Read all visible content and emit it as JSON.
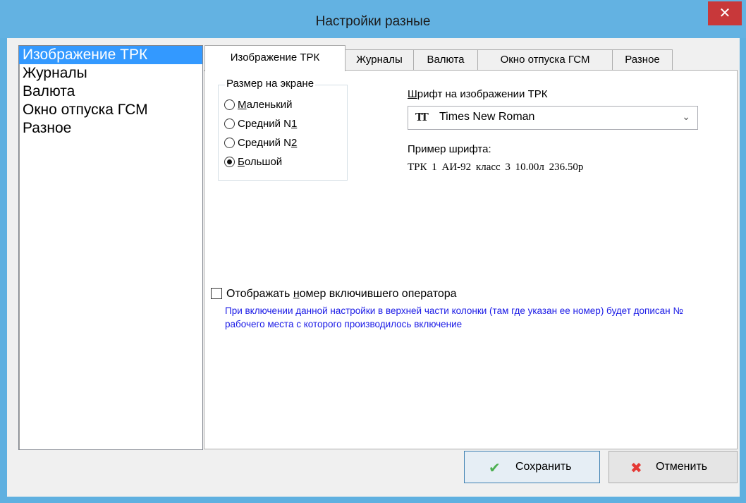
{
  "window": {
    "title": "Настройки разные",
    "close_glyph": "✕"
  },
  "sidebar": {
    "items": [
      {
        "label": "Изображение ТРК",
        "selected": true
      },
      {
        "label": "Журналы"
      },
      {
        "label": "Валюта"
      },
      {
        "label": "Окно отпуска ГСМ"
      },
      {
        "label": "Разное"
      }
    ]
  },
  "tabs": [
    {
      "label": "Изображение ТРК",
      "active": true
    },
    {
      "label": "Журналы"
    },
    {
      "label": "Валюта"
    },
    {
      "label": "Окно отпуска ГСМ"
    },
    {
      "label": "Разное"
    }
  ],
  "screen_size_group": {
    "title": "Размер на экране",
    "options": [
      {
        "label": "Маленький",
        "checked": false
      },
      {
        "label": "Средний N1",
        "checked": false
      },
      {
        "label": "Средний N2",
        "checked": false
      },
      {
        "label": "Большой",
        "checked": true
      }
    ]
  },
  "font": {
    "label": "Шрифт на изображении ТРК",
    "icon": "truetype-font-icon",
    "value": "Times New Roman",
    "sample_label": "Пример шрифта:",
    "sample_text": "ТРК 1   АИ-92  класс 3   10.00л   236.50р"
  },
  "operator_option": {
    "label": "Отображать номер включившего оператора",
    "checked": false,
    "hint": "При включении данной настройки в верхней части колонки (там где указан ее номер) будет дописан № рабочего места с которого производилось включение"
  },
  "buttons": {
    "save": {
      "label": "Сохранить",
      "icon": "checkmark-icon",
      "icon_color": "#4caf50"
    },
    "cancel": {
      "label": "Отменить",
      "icon": "cross-icon",
      "icon_color": "#e53935"
    }
  },
  "colors": {
    "title_bar": "#63b2e2",
    "close_button": "#c8383a",
    "selection": "#3399ff",
    "hint_text": "#1a1ae6"
  }
}
